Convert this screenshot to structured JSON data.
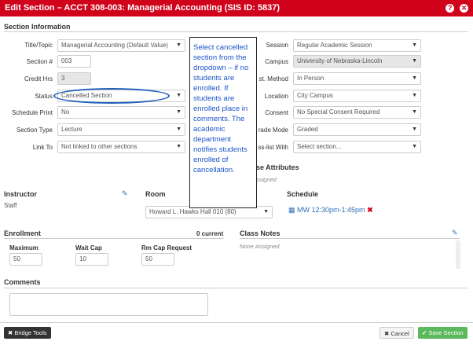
{
  "title": "Edit Section – ACCT 308-003: Managerial Accounting (SIS ID: 5837)",
  "title_icons": [
    "?",
    "✕"
  ],
  "section_info": "Section Information",
  "left_fields": {
    "title_topic": {
      "label": "Title/Topic",
      "value": "Managerial Accounting (Default Value)"
    },
    "section_num": {
      "label": "Section #",
      "value": "003"
    },
    "credit_hrs": {
      "label": "Credit Hrs",
      "value": "3"
    },
    "status": {
      "label": "Status",
      "value": "Cancelled Section"
    },
    "schedule_print": {
      "label": "Schedule Print",
      "value": "No"
    },
    "section_type": {
      "label": "Section Type",
      "value": "Lecture"
    },
    "link_to": {
      "label": "Link To",
      "value": "Not linked to other sections"
    }
  },
  "right_fields": {
    "session": {
      "label": "Session",
      "value": "Regular Academic Session"
    },
    "campus": {
      "label": "Campus",
      "value": "University of Nebraska-Lincoln"
    },
    "inst_method": {
      "label": "st. Method",
      "value": "In Person"
    },
    "location": {
      "label": "Location",
      "value": "City Campus"
    },
    "consent": {
      "label": "Consent",
      "value": "No Special Consent Required"
    },
    "grade_mode": {
      "label": "rade Mode",
      "value": "Graded"
    },
    "crosslist": {
      "label": "ss-list With",
      "value": "Select section..."
    }
  },
  "attributes": {
    "title": "se Attributes",
    "note": "ssigned"
  },
  "note": "Select cancelled section from the dropdown – if no students are enrolled. If students are enrolled place in comments. The academic department notifies students enrolled of cancellation.",
  "instructor": {
    "title": "Instructor",
    "value": "Staff"
  },
  "room": {
    "title": "Room",
    "value": "Howard L. Hawks Hall 010 (80)"
  },
  "schedule": {
    "title": "Schedule",
    "value": "MW 12:30pm-1:45pm"
  },
  "enrollment": {
    "title": "Enrollment",
    "current": "0 current",
    "maximum": {
      "label": "Maximum",
      "value": "50"
    },
    "wait_cap": {
      "label": "Wait Cap",
      "value": "10"
    },
    "rm_cap": {
      "label": "Rm Cap Request",
      "value": "50"
    }
  },
  "class_notes": {
    "title": "Class Notes",
    "value": "None Assigned"
  },
  "comments": {
    "title": "Comments"
  },
  "buttons": {
    "bridge": "Bridge Tools",
    "cancel": "Cancel",
    "save": "Save Section"
  },
  "colors": {
    "titlebar": "#d0021b",
    "note_text": "#1a55c8",
    "save": "#5cb85c"
  }
}
